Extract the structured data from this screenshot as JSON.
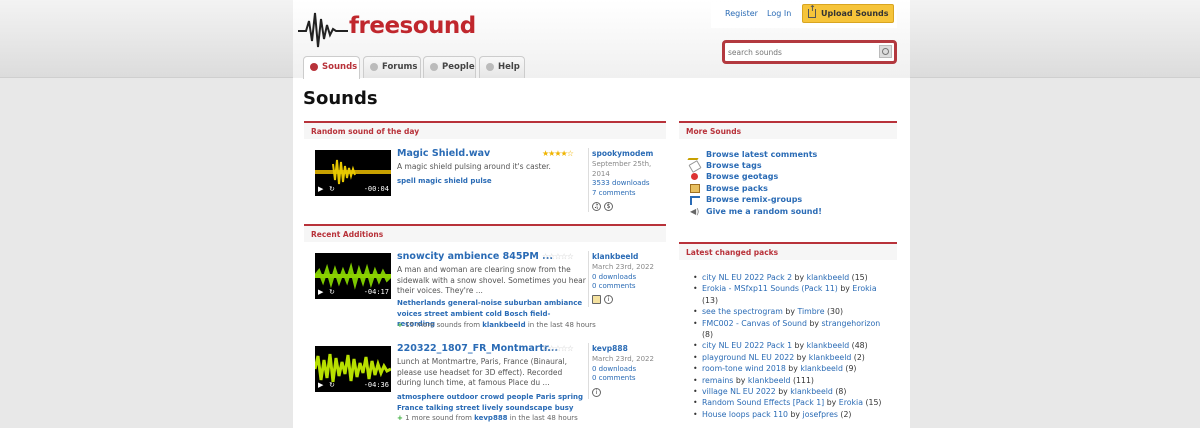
{
  "header": {
    "logo_text": "freesound",
    "register": "Register",
    "login": "Log In",
    "upload": "Upload Sounds",
    "search_placeholder": "search sounds"
  },
  "tabs": [
    {
      "label": "Sounds",
      "active": true
    },
    {
      "label": "Forums"
    },
    {
      "label": "People"
    },
    {
      "label": "Help"
    }
  ],
  "page_title": "Sounds",
  "random": {
    "heading": "Random sound of the day",
    "title": "Magic Shield.wav",
    "stars": "★★★★☆",
    "description": "A magic shield pulsing around it's caster.",
    "tags": "spell  magic  shield  pulse",
    "user": "spookymodem",
    "date": "September 25th, 2014",
    "downloads": "3533 downloads",
    "comments": "7 comments",
    "duration": "-00:04"
  },
  "recent": {
    "heading": "Recent Additions",
    "items": [
      {
        "title": "snowcity ambience 845PM ...",
        "stars": "☆☆☆☆☆",
        "description": "A man and woman are clearing snow from the sidewalk with a snow shovel. Sometimes you hear their voices. They're ...",
        "tags": "Netherlands  general-noise  suburban  ambiance  voices  street  ambient  cold  Bosch  field-recording",
        "user": "klankbeeld",
        "date": "March 23rd, 2022",
        "downloads": "0 downloads",
        "comments": "0 comments",
        "duration": "-04:17",
        "more_prefix": "15 more sounds from",
        "more_user": "klankbeeld",
        "more_suffix": "in the last 48 hours"
      },
      {
        "title": "220322_1807_FR_Montmartr...",
        "stars": "☆☆☆☆☆",
        "description": "Lunch at Montmartre, Paris, France (Binaural, please use headset for 3D effect). Recorded during lunch time, at famous Place du ...",
        "tags": "atmosphere  outdoor  crowd  people  Paris  spring  France  talking  street  lively  soundscape  busy",
        "user": "kevp888",
        "date": "March 23rd, 2022",
        "downloads": "0 downloads",
        "comments": "0 comments",
        "duration": "-04:36",
        "more_prefix": "1 more sound from",
        "more_user": "kevp888",
        "more_suffix": "in the last 48 hours"
      }
    ]
  },
  "more_sounds": {
    "heading": "More Sounds",
    "items": [
      {
        "label": "Browse latest comments",
        "icon": "pencil-icon"
      },
      {
        "label": "Browse tags",
        "icon": "tag-icon"
      },
      {
        "label": "Browse geotags",
        "icon": "map-pin-icon"
      },
      {
        "label": "Browse packs",
        "icon": "package-icon"
      },
      {
        "label": "Browse remix-groups",
        "icon": "remix-icon"
      },
      {
        "label": "Give me a random sound!",
        "icon": "speaker-icon"
      }
    ]
  },
  "packs": {
    "heading": "Latest changed packs",
    "items": [
      {
        "name": "city NL EU 2022 Pack 2",
        "user": "klankbeeld",
        "count": "(15)"
      },
      {
        "name": "Erokia - MSfxp11 Sounds (Pack 11)",
        "user": "Erokia",
        "count": "(13)"
      },
      {
        "name": "see the spectrogram",
        "user": "Timbre",
        "count": "(30)"
      },
      {
        "name": "FMC002 - Canvas of Sound",
        "user": "strangehorizon",
        "count": "(8)"
      },
      {
        "name": "city NL EU 2022 Pack 1",
        "user": "klankbeeld",
        "count": "(48)"
      },
      {
        "name": "playground NL EU 2022",
        "user": "klankbeeld",
        "count": "(2)"
      },
      {
        "name": "room-tone wind 2018",
        "user": "klankbeeld",
        "count": "(9)"
      },
      {
        "name": "remains",
        "user": "klankbeeld",
        "count": "(111)"
      },
      {
        "name": "village NL EU 2022",
        "user": "klankbeeld",
        "count": "(8)"
      },
      {
        "name": "Random Sound Effects [Pack 1]",
        "user": "Erokia",
        "count": "(15)"
      },
      {
        "name": "House loops pack 110",
        "user": "josefpres",
        "count": "(2)"
      }
    ],
    "by": "by"
  }
}
